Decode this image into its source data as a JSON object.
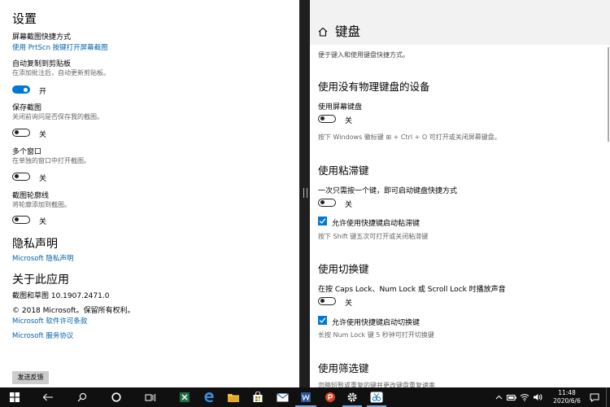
{
  "left": {
    "title": "设置",
    "screenshot_shortcut": {
      "label": "屏幕截图快捷方式",
      "link": "使用 PrtScn 按键打开屏幕截图"
    },
    "auto_copy": {
      "label": "自动复制到剪贴板",
      "desc": "在添加批注后，自动更新剪贴板。",
      "state": "开"
    },
    "save_snips": {
      "label": "保存截图",
      "desc": "关闭前询问是否保存我的截图。",
      "state": "关"
    },
    "multiple_windows": {
      "label": "多个窗口",
      "desc": "在单独的窗口中打开截图。",
      "state": "关"
    },
    "snip_outline": {
      "label": "截图轮廓线",
      "desc": "将轮廓添加到截图。",
      "state": "关"
    },
    "privacy": {
      "heading": "隐私声明",
      "link": "Microsoft 隐私声明"
    },
    "about": {
      "heading": "关于此应用",
      "version": "截图和草图 10.1907.2471.0",
      "copyright": "© 2018 Microsoft。保留所有权利。",
      "license_link": "Microsoft 软件许可条款",
      "services_link": "Microsoft 服务协议"
    },
    "feedback_button": "发送反馈"
  },
  "right": {
    "title": "键盘",
    "subtitle": "便于键入和使用键盘快捷方式。",
    "no_physical_keyboard": {
      "heading": "使用没有物理键盘的设备",
      "label": "使用屏幕键盘",
      "state": "关",
      "desc": "按下 Windows 徽标键 ⊞ + Ctrl + O 可打开或关闭屏幕键盘。"
    },
    "sticky_keys": {
      "heading": "使用粘滞键",
      "label": "一次只需按一个键，即可启动键盘快捷方式",
      "state": "关",
      "checkbox_label": "允许使用快捷键启动粘滞键",
      "desc": "按下 Shift 键五次可打开或关闭粘滞键"
    },
    "toggle_keys": {
      "heading": "使用切换键",
      "label": "在按 Caps Lock、Num Lock 或 Scroll Lock 时播放声音",
      "state": "关",
      "checkbox_label": "允许使用快捷键启动切换键",
      "desc": "长按 Num Lock 键 5 秒钟可打开切换键"
    },
    "filter_keys": {
      "heading": "使用筛选键",
      "desc": "忽略短暂或重复的键并更改键盘重复速率"
    }
  },
  "taskbar": {
    "time": "11:48",
    "date": "2020/6/6"
  },
  "colors": {
    "accent": "#0078d7",
    "link": "#0063b1",
    "taskbar": "#101010"
  }
}
